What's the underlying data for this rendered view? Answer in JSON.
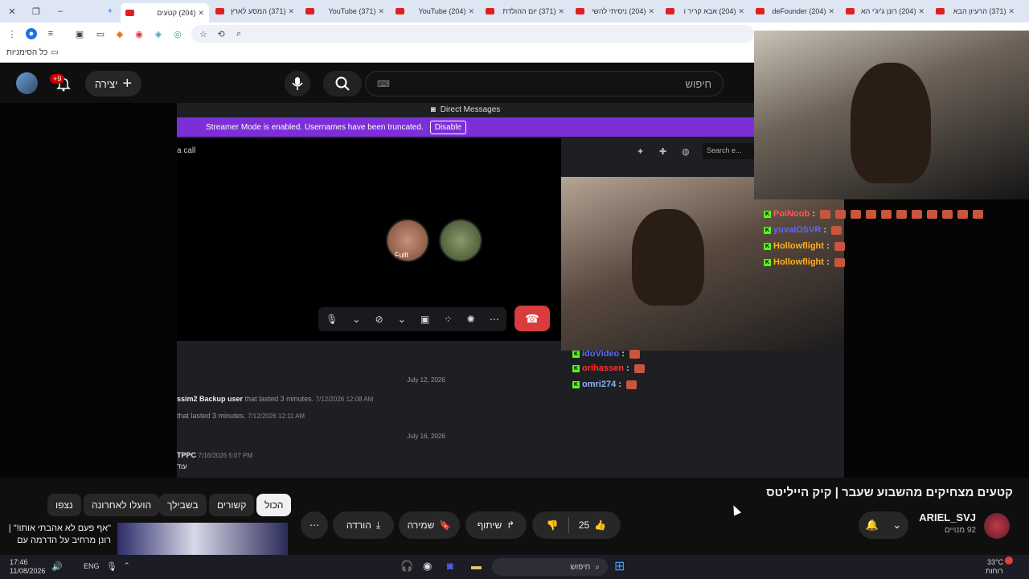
{
  "browser": {
    "tabs": [
      {
        "label": "(204) קטעים",
        "active": true
      },
      {
        "label": "(371) המסע לארץ"
      },
      {
        "label": "(371) YouTube"
      },
      {
        "label": "(204) YouTube"
      },
      {
        "label": "(371) יום ההולדת"
      },
      {
        "label": "(204) ניסיתי להשי"
      },
      {
        "label": "(204) אבא קריר ו"
      },
      {
        "label": "(204) deFounder"
      },
      {
        "label": "(204) רונן ג'יג'י הא"
      },
      {
        "label": "(371) הרעיון הבא"
      }
    ],
    "bookmarks_label": "כל הסימניות"
  },
  "youtube_header": {
    "search_placeholder": "חיפוש",
    "create_label": "יצירה",
    "notif_count": "+9"
  },
  "discord": {
    "dm_label": "Direct Messages",
    "streamer_notice": "Streamer Mode is enabled. Usernames have been truncated.",
    "disable_label": "Disable",
    "call_title": "a call",
    "search_placeholder": "Search e...",
    "dates": [
      "July 12, 2026",
      "July 16, 2026"
    ],
    "messages": [
      {
        "user": "ssim2 Backup user",
        "text": "that lasted 3 minutes.",
        "time": "7/12/2026 12:08 AM"
      },
      {
        "user": "",
        "text": "that lasted 3 minutes.",
        "time": "7/12/2026 12:11 AM"
      },
      {
        "user": "TPPC",
        "text": "",
        "time": "7/16/2026 5:07 PM"
      },
      {
        "user": "",
        "text": "עוד",
        "time": ""
      }
    ],
    "avatar_text": "Fullt"
  },
  "chat": [
    {
      "name": "PoiNoob",
      "color": "#ff5a5a"
    },
    {
      "name": "yuvaIOSVR",
      "color": "#5a6aff"
    },
    {
      "name": "Hollowflight",
      "color": "#ffb020"
    },
    {
      "name": "Hollowflight",
      "color": "#ffb020"
    }
  ],
  "chat2": [
    {
      "name": "idoVideo",
      "color": "#5a6aff"
    },
    {
      "name": "orihassen",
      "color": "#ff3030"
    },
    {
      "name": "omri274",
      "color": "#8ab4f8"
    }
  ],
  "video": {
    "title": "קטעים מצחיקים מהשבוע שעבר | קיק הייליטס",
    "channel": "ARIEL_SVJ",
    "subscribers": "92 מנויים",
    "likes": "25",
    "share_label": "שיתוף",
    "save_label": "שמירה",
    "download_label": "הורדה"
  },
  "chips": [
    "הכול",
    "קשורים",
    "בשבילך",
    "הועלו לאחרונה",
    "נצפו"
  ],
  "related": {
    "title": "\"אף פעם לא אהבתי אותו!\" | רונן מרחיב על הדרמה עם"
  },
  "taskbar": {
    "time": "17:46",
    "date": "11/08/2026",
    "lang": "ENG",
    "search_label": "חיפוש",
    "weather_temp": "33°C",
    "weather_label": "רוחות"
  },
  "colors": {
    "accent": "#7c2fd6",
    "hangup": "#d83c3e",
    "yt_red": "#e02020",
    "kick_green": "#53fc18"
  }
}
